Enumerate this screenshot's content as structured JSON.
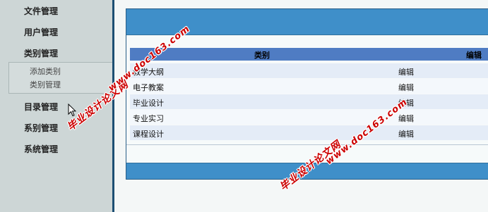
{
  "sidebar": {
    "items": [
      {
        "label": "文件管理"
      },
      {
        "label": "用户管理"
      },
      {
        "label": "类别管理"
      },
      {
        "label": "目录管理"
      },
      {
        "label": "系别管理"
      },
      {
        "label": "系统管理"
      }
    ],
    "submenu": [
      {
        "label": "添加类别"
      },
      {
        "label": "类别管理"
      }
    ]
  },
  "table": {
    "columns": [
      "类别",
      "编辑"
    ],
    "rows": [
      {
        "category": "教学大纲",
        "action": "编辑"
      },
      {
        "category": "电子教案",
        "action": "编辑"
      },
      {
        "category": "毕业设计",
        "action": "编辑"
      },
      {
        "category": "专业实习",
        "action": "编辑"
      },
      {
        "category": "课程设计",
        "action": "编辑"
      }
    ]
  },
  "watermarks": {
    "site_name": "毕业设计论文网",
    "url": "www.doc163.com"
  },
  "colors": {
    "sidebar_bg": "#cdd6d6",
    "header_bar": "#3f8fc9",
    "table_head": "#4f7cc3",
    "watermark": "#cc0000"
  }
}
